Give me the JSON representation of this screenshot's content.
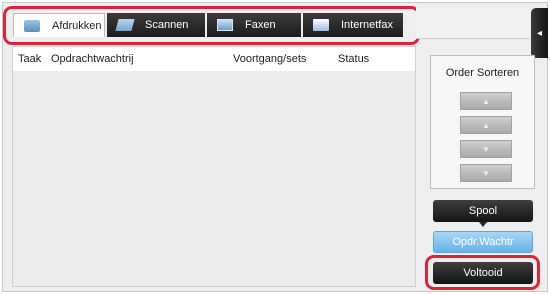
{
  "tabs": [
    {
      "label": "Afdrukken",
      "icon": "printer-icon",
      "active": true
    },
    {
      "label": "Scannen",
      "icon": "scanner-icon",
      "active": false
    },
    {
      "label": "Faxen",
      "icon": "fax-icon",
      "active": false
    },
    {
      "label": "Internetfax",
      "icon": "internet-fax-icon",
      "active": false
    }
  ],
  "job_list": {
    "columns": [
      "Taak",
      "Opdrachtwachtrij",
      "Voortgang/sets",
      "Status"
    ],
    "rows": []
  },
  "sidebar": {
    "collapse_glyph": "◂",
    "order_sort_title": "Order Sorteren",
    "sort_buttons": [
      "▲",
      "▲",
      "▼",
      "▼"
    ],
    "spool_label": "Spool",
    "queue_label": "Opdr.Wachtr",
    "completed_label": "Voltooid"
  },
  "colors": {
    "highlight": "#e0213a",
    "selected_mode": "#7cc0ee"
  }
}
